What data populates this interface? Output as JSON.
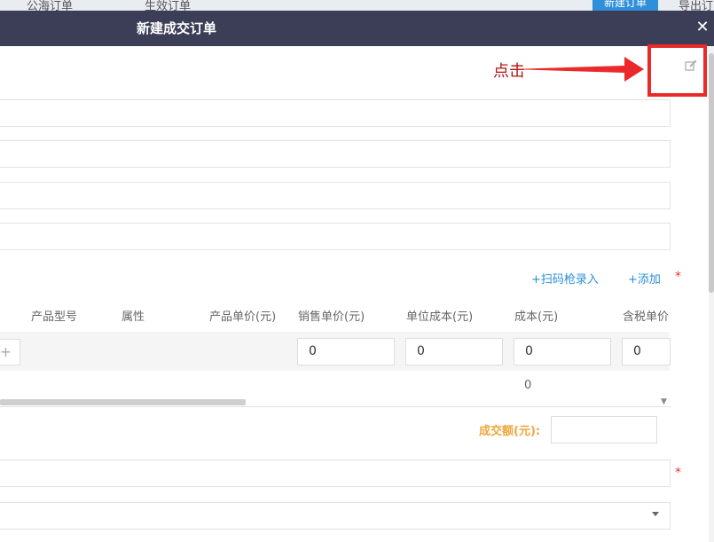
{
  "background": {
    "tab1": "公海订单",
    "tab2": "生效订单",
    "new_order_button": "新建订单",
    "export": "导出订"
  },
  "modal": {
    "title": "新建成交订单",
    "close_icon": "close-icon"
  },
  "products": {
    "scan_link": "+扫码枪录入",
    "add_link": "+添加",
    "required_mark": "*",
    "columns": [
      "产品型号",
      "属性",
      "产品单价(元)",
      "销售单价(元)",
      "单位成本(元)",
      "成本(元)",
      "含税单价"
    ],
    "row": {
      "add_icon": "+",
      "sale_price": "0",
      "unit_cost": "0",
      "cost": "0",
      "tax_price": "0"
    },
    "total_cost": "0"
  },
  "deal": {
    "amount_label": "成交额(元):",
    "amount_value": ""
  },
  "field_required_mark": "*",
  "annotation": {
    "text": "点击",
    "icon": "edit-icon",
    "color": "#ea2a2a"
  }
}
